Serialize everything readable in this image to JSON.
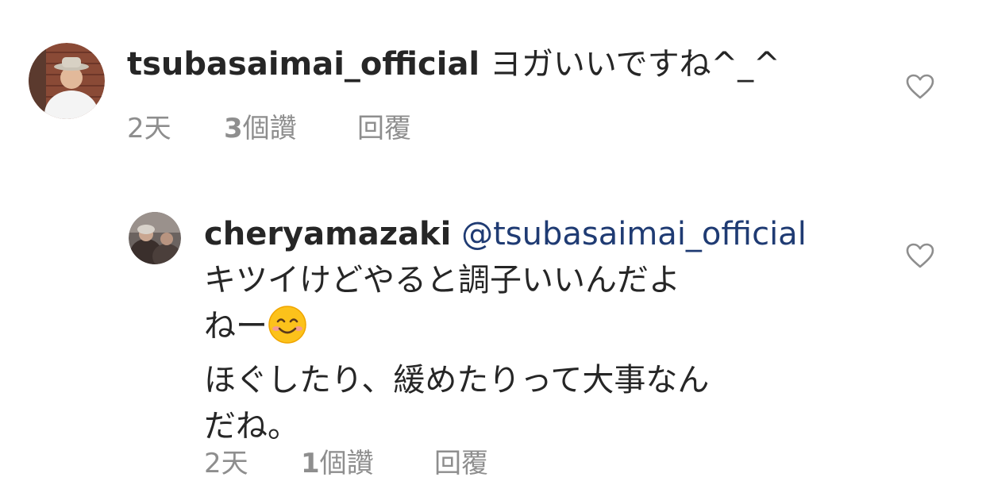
{
  "comments": [
    {
      "username": "tsubasaimai_official",
      "text": "ヨガいいですね^_^",
      "time": "2天",
      "likes": "3",
      "likes_label": "個讚",
      "reply_label": "回覆"
    },
    {
      "username": "cheryamazaki",
      "mention": "@tsubasaimai_official",
      "line1": "キツイけどやると調子いいんだよ",
      "line2": "ねー",
      "line3": "ほぐしたり、緩めたりって大事なん",
      "line4": "だね。",
      "time": "2天",
      "likes": "1",
      "likes_label": "個讚",
      "reply_label": "回覆"
    }
  ],
  "colors": {
    "text": "#262626",
    "meta": "#8e8e8e",
    "mention": "#1f3b73",
    "heart_stroke": "#8e8e8e"
  },
  "icons": {
    "like": "heart-outline-icon",
    "emoji": "smiling-face-with-smiling-eyes"
  }
}
